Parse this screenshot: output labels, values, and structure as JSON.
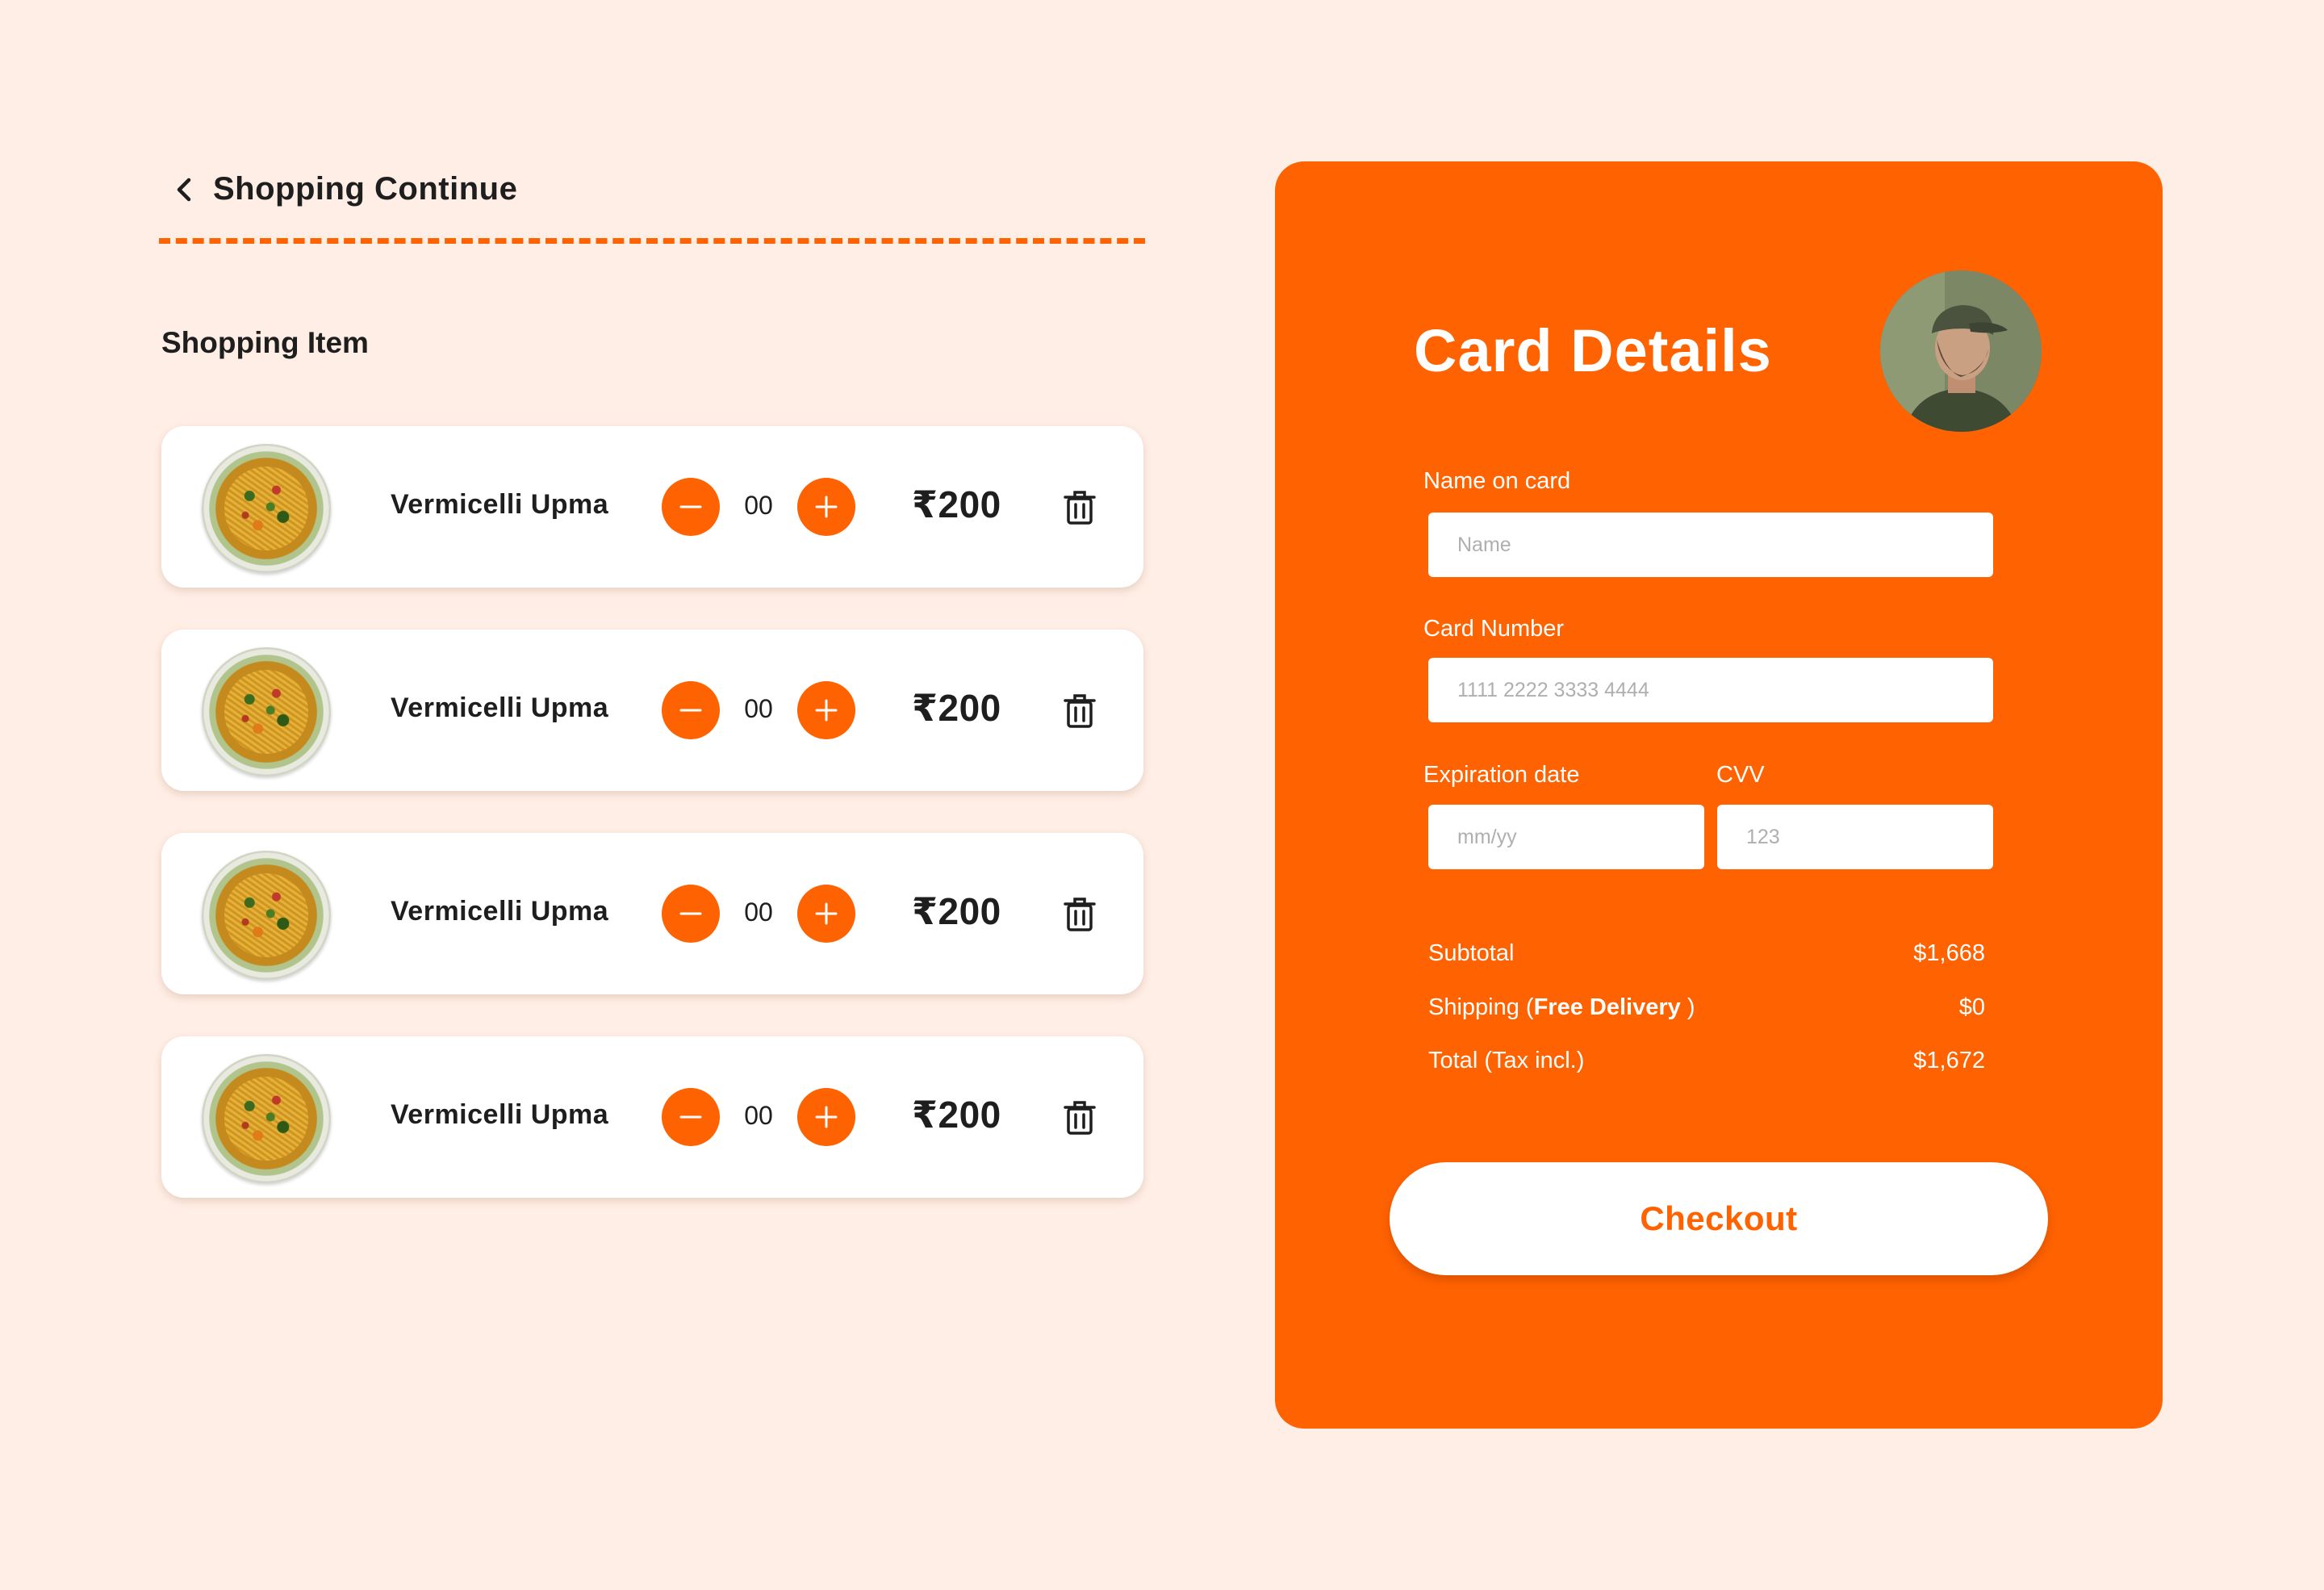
{
  "header": {
    "back_label": "Shopping Continue"
  },
  "cart": {
    "section_title": "Shopping Item",
    "items": [
      {
        "name": "Vermicelli Upma",
        "quantity": "00",
        "price": "₹200"
      },
      {
        "name": "Vermicelli Upma",
        "quantity": "00",
        "price": "₹200"
      },
      {
        "name": "Vermicelli Upma",
        "quantity": "00",
        "price": "₹200"
      },
      {
        "name": "Vermicelli Upma",
        "quantity": "00",
        "price": "₹200"
      }
    ]
  },
  "card": {
    "title": "Card Details",
    "name_label": "Name on card",
    "name_placeholder": "Name",
    "number_label": "Card Number",
    "number_placeholder": "1111 2222 3333 4444",
    "expiry_label": "Expiration date",
    "expiry_placeholder": "mm/yy",
    "cvv_label": "CVV",
    "cvv_placeholder": "123"
  },
  "summary": {
    "subtotal_label": "Subtotal",
    "subtotal_value": "$1,668",
    "shipping_label_prefix": "Shipping (",
    "shipping_label_bold": "Free Delivery",
    "shipping_label_suffix": " )",
    "shipping_value": "$0",
    "total_label": "Total (Tax incl.)",
    "total_value": "$1,672"
  },
  "checkout_label": "Checkout",
  "colors": {
    "accent": "#FF6200",
    "background": "#FFEEE5",
    "card": "#FFFFFF",
    "text": "#1E1E1E"
  },
  "icons": {
    "back": "chevron-left-icon",
    "minus": "minus-icon",
    "plus": "plus-icon",
    "delete": "trash-icon"
  }
}
